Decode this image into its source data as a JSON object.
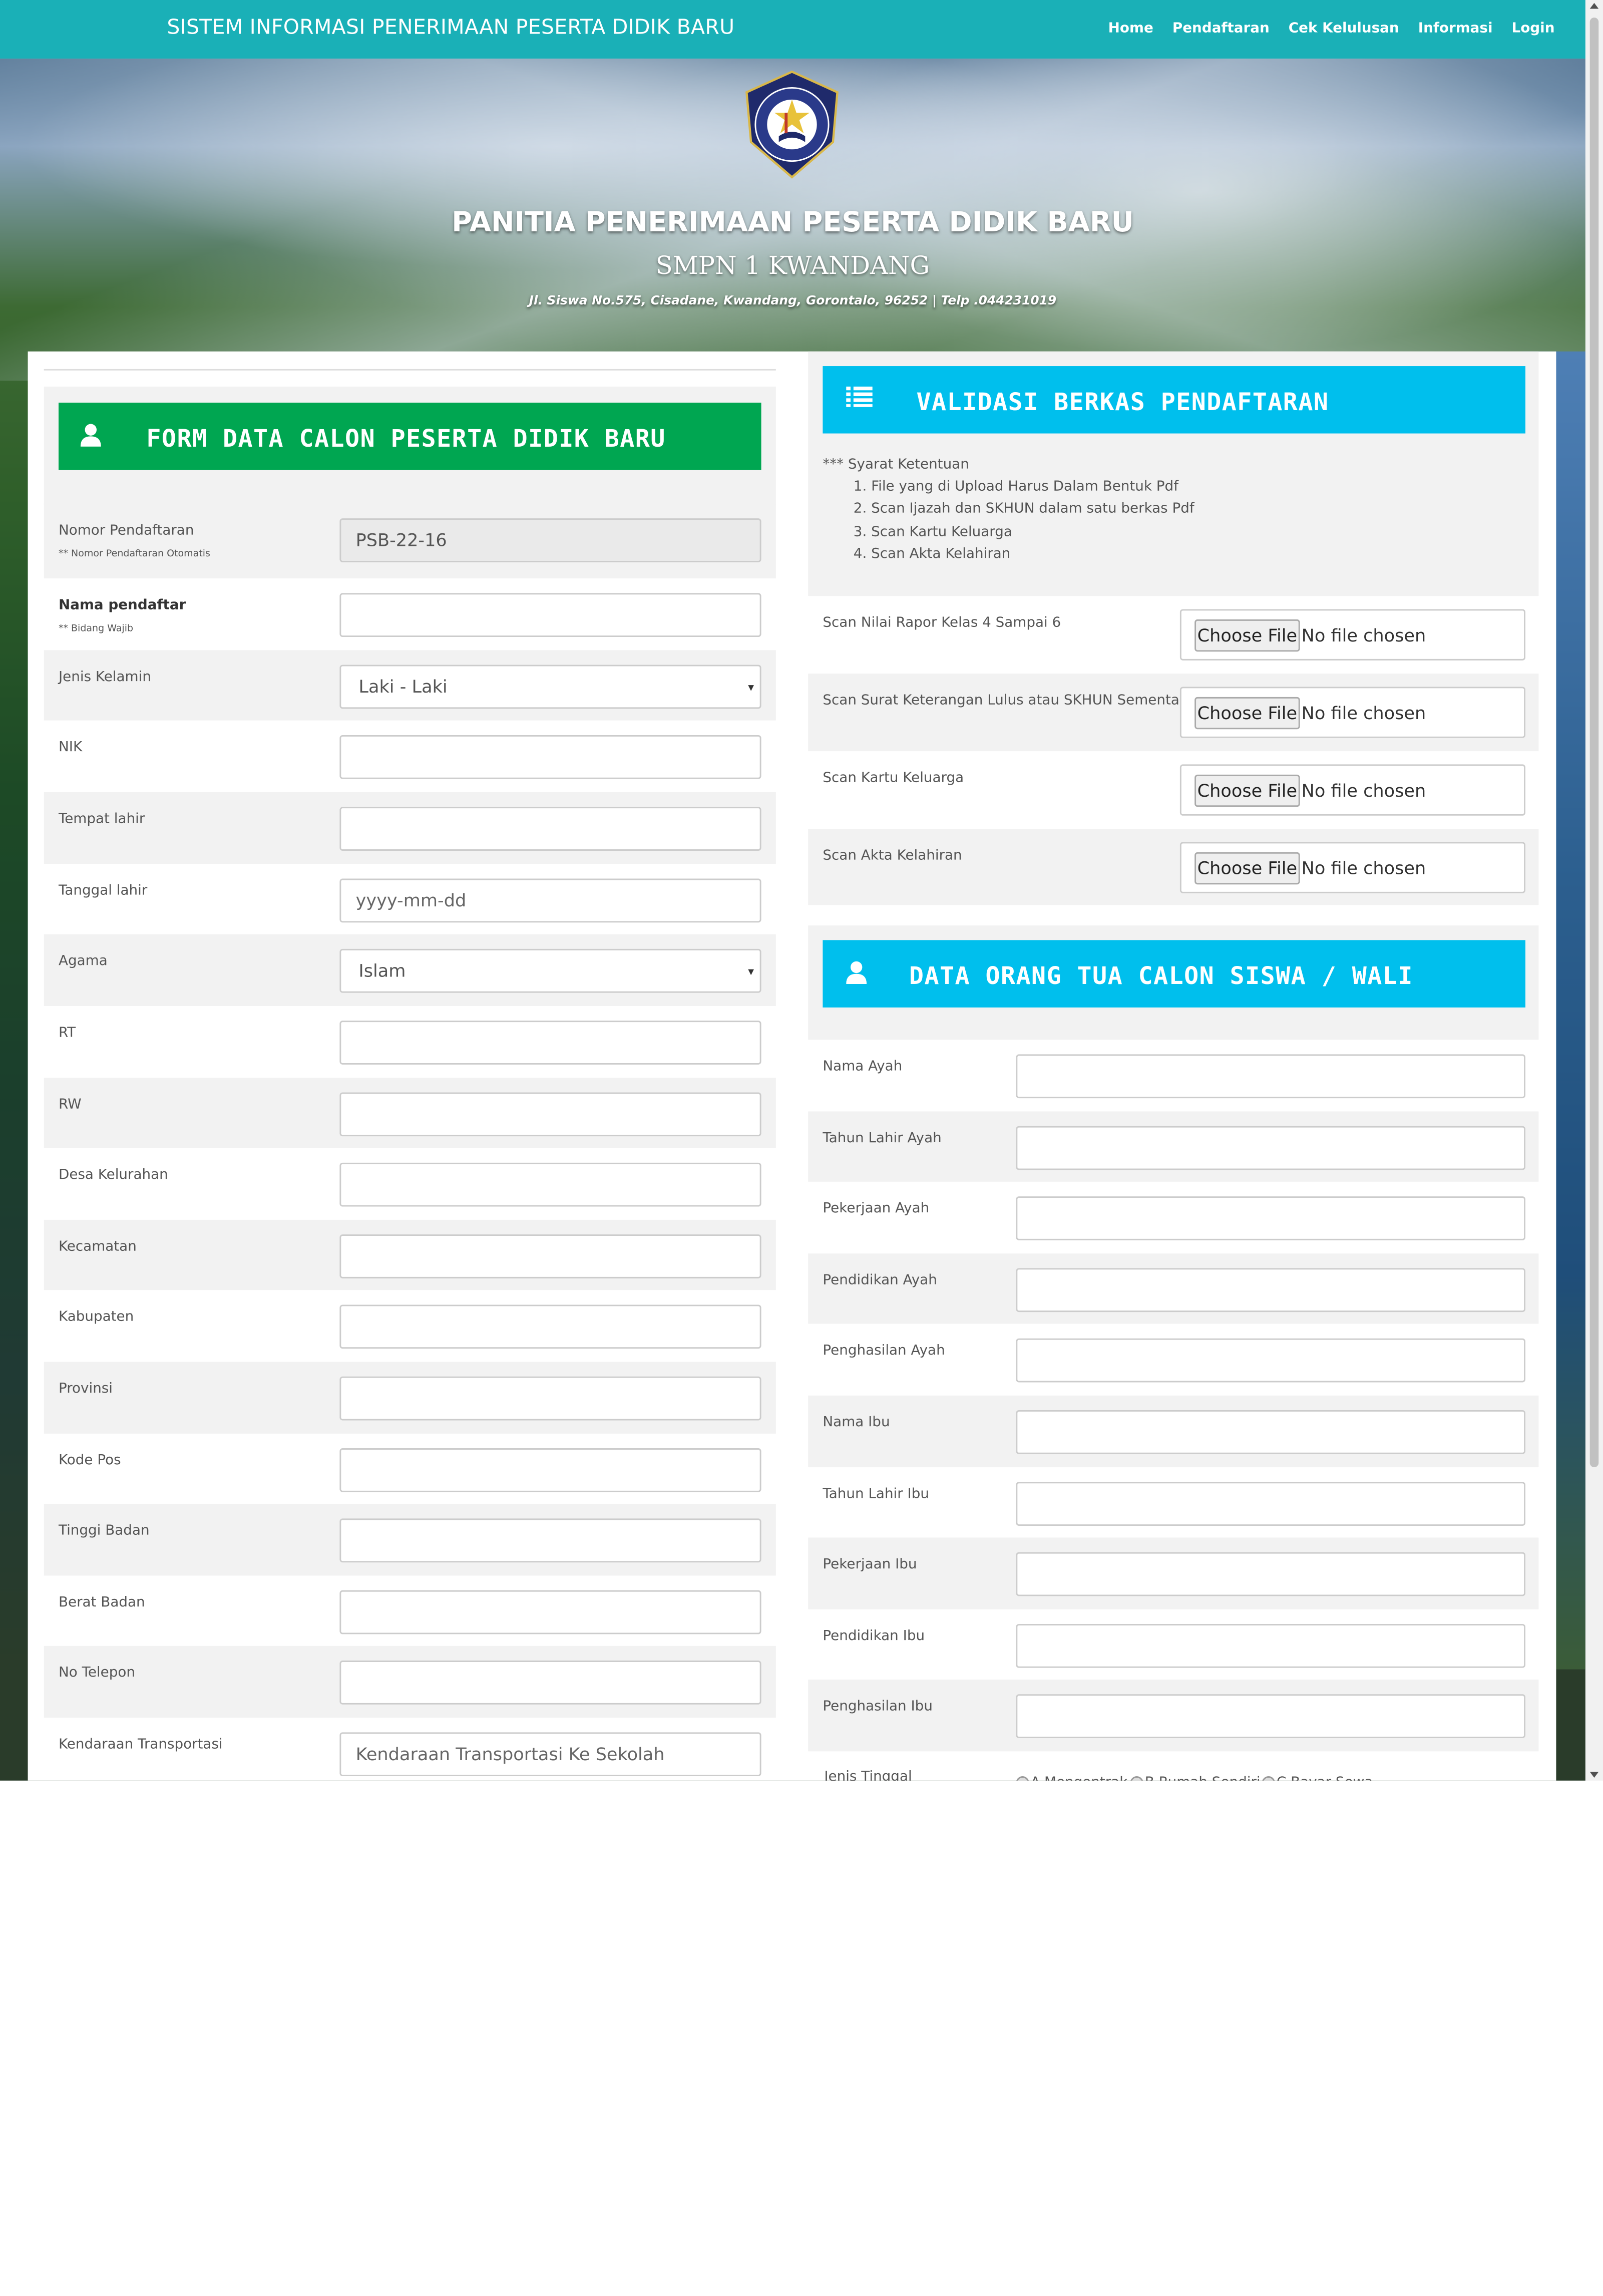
{
  "navbar": {
    "brand": "SISTEM INFORMASI PENERIMAAN PESERTA DIDIK BARU",
    "menu": [
      "Home",
      "Pendaftaran",
      "Cek Kelulusan",
      "Informasi",
      "Login"
    ]
  },
  "header": {
    "title": "PANITIA PENERIMAAN PESERTA DIDIK BARU",
    "school": "SMPN 1 KWANDANG",
    "address": "Jl. Siswa No.575, Cisadane, Kwandang, Gorontalo, 96252 | Telp .044231019"
  },
  "form_left": {
    "title": "FORM DATA CALON PESERTA DIDIK BARU",
    "fields": [
      {
        "label": "Nomor Pendaftaran",
        "hint": "** Nomor Pendaftaran Otomatis",
        "value": "PSB-22-16",
        "placeholder": ""
      },
      {
        "label": "Nama pendaftar",
        "hint": "** Bidang Wajib",
        "value": "",
        "placeholder": ""
      },
      {
        "label": "Jenis Kelamin",
        "hint": "",
        "value": "Laki - Laki",
        "placeholder": ""
      },
      {
        "label": "NIK",
        "hint": "",
        "value": "",
        "placeholder": ""
      },
      {
        "label": "Tempat lahir",
        "hint": "",
        "value": "",
        "placeholder": ""
      },
      {
        "label": "Tanggal lahir",
        "hint": "",
        "value": "",
        "placeholder": "yyyy-mm-dd"
      },
      {
        "label": "Agama",
        "hint": "",
        "value": "Islam",
        "placeholder": ""
      },
      {
        "label": "RT",
        "hint": "",
        "value": "",
        "placeholder": ""
      },
      {
        "label": "RW",
        "hint": "",
        "value": "",
        "placeholder": ""
      },
      {
        "label": "Desa Kelurahan",
        "hint": "",
        "value": "",
        "placeholder": ""
      },
      {
        "label": "Kecamatan",
        "hint": "",
        "value": "",
        "placeholder": ""
      },
      {
        "label": "Kabupaten",
        "hint": "",
        "value": "",
        "placeholder": ""
      },
      {
        "label": "Provinsi",
        "hint": "",
        "value": "",
        "placeholder": ""
      },
      {
        "label": "Kode Pos",
        "hint": "",
        "value": "",
        "placeholder": ""
      },
      {
        "label": "Tinggi Badan",
        "hint": "",
        "value": "",
        "placeholder": ""
      },
      {
        "label": "Berat Badan",
        "hint": "",
        "value": "",
        "placeholder": ""
      },
      {
        "label": "No Telepon",
        "hint": "",
        "value": "",
        "placeholder": ""
      },
      {
        "label": "Kendaraan Transportasi",
        "hint": "",
        "value": "",
        "placeholder": "Kendaraan Transportasi Ke Sekolah"
      }
    ]
  },
  "validasi": {
    "title": "VALIDASI BERKAS PENDAFTARAN",
    "terms_title": "*** Syarat Ketentuan",
    "terms": [
      "1. File yang di Upload Harus Dalam Bentuk Pdf",
      "2. Scan Ijazah dan SKHUN dalam satu berkas Pdf",
      "3. Scan Kartu Keluarga",
      "4. Scan Akta Kelahiran"
    ],
    "uploads": [
      {
        "label": "Scan Nilai Rapor Kelas 4 Sampai 6",
        "button": "Choose File",
        "status": "No file chosen"
      },
      {
        "label": "Scan Surat Keterangan Lulus atau SKHUN Sementara",
        "button": "Choose File",
        "status": "No file chosen"
      },
      {
        "label": "Scan Kartu Keluarga",
        "button": "Choose File",
        "status": "No file chosen"
      },
      {
        "label": "Scan Akta Kelahiran",
        "button": "Choose File",
        "status": "No file chosen"
      }
    ]
  },
  "orang_tua": {
    "title": "DATA ORANG TUA CALON SISWA / WALI",
    "fields": [
      "Nama Ayah",
      "Tahun Lahir Ayah",
      "Pekerjaan Ayah",
      "Pendidikan Ayah",
      "Penghasilan Ayah",
      "Nama Ibu",
      "Tahun Lahir Ibu",
      "Pekerjaan Ibu",
      "Pendidikan Ibu",
      "Penghasilan Ibu"
    ],
    "jenis_tinggal_label": "Jenis Tinggal",
    "jenis_tinggal_options": [
      "A.Mengontrak",
      "B.Rumah Sendiri",
      "C.Bayar Sewa"
    ]
  },
  "colors": {
    "navbar": "#1ab0b7",
    "form_header": "#00a651",
    "validasi_header": "#00bfed"
  }
}
